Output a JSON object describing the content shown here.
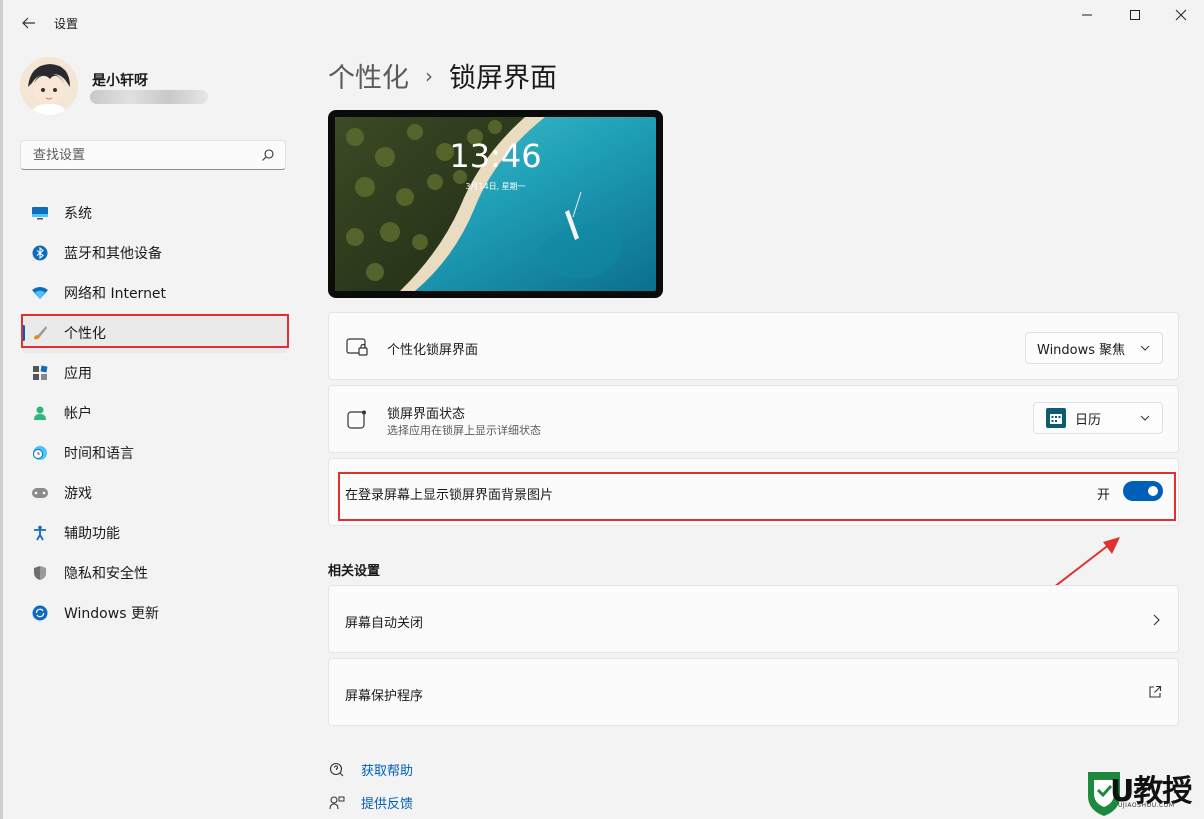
{
  "window": {
    "title": "设置"
  },
  "user": {
    "name": "是小轩呀"
  },
  "search": {
    "placeholder": "查找设置"
  },
  "sidebar": {
    "items": [
      {
        "label": "系统",
        "icon": "monitor-icon"
      },
      {
        "label": "蓝牙和其他设备",
        "icon": "bluetooth-icon"
      },
      {
        "label": "网络和 Internet",
        "icon": "wifi-icon"
      },
      {
        "label": "个性化",
        "icon": "brush-icon",
        "active": true
      },
      {
        "label": "应用",
        "icon": "apps-icon"
      },
      {
        "label": "帐户",
        "icon": "person-icon"
      },
      {
        "label": "时间和语言",
        "icon": "clock-globe-icon"
      },
      {
        "label": "游戏",
        "icon": "gamepad-icon"
      },
      {
        "label": "辅助功能",
        "icon": "accessibility-icon"
      },
      {
        "label": "隐私和安全性",
        "icon": "shield-icon"
      },
      {
        "label": "Windows 更新",
        "icon": "update-icon"
      }
    ]
  },
  "breadcrumb": {
    "parent": "个性化",
    "separator": "›",
    "current": "锁屏界面"
  },
  "preview": {
    "time": "13:46",
    "date": "3月14日, 星期一"
  },
  "settings": {
    "personalize_lock": {
      "title": "个性化锁屏界面",
      "value": "Windows 聚焦"
    },
    "lock_status": {
      "title": "锁屏界面状态",
      "subtitle": "选择应用在锁屏上显示详细状态",
      "value": "日历"
    },
    "show_background": {
      "title": "在登录屏幕上显示锁屏界面背景图片",
      "state_label": "开",
      "on": true
    }
  },
  "related": {
    "title": "相关设置",
    "items": [
      {
        "label": "屏幕自动关闭",
        "icon": "chevron-right-icon"
      },
      {
        "label": "屏幕保护程序",
        "icon": "open-external-icon"
      }
    ]
  },
  "footer": {
    "help": "获取帮助",
    "feedback": "提供反馈"
  },
  "colors": {
    "accent": "#005fb8",
    "annotation": "#e03131"
  }
}
